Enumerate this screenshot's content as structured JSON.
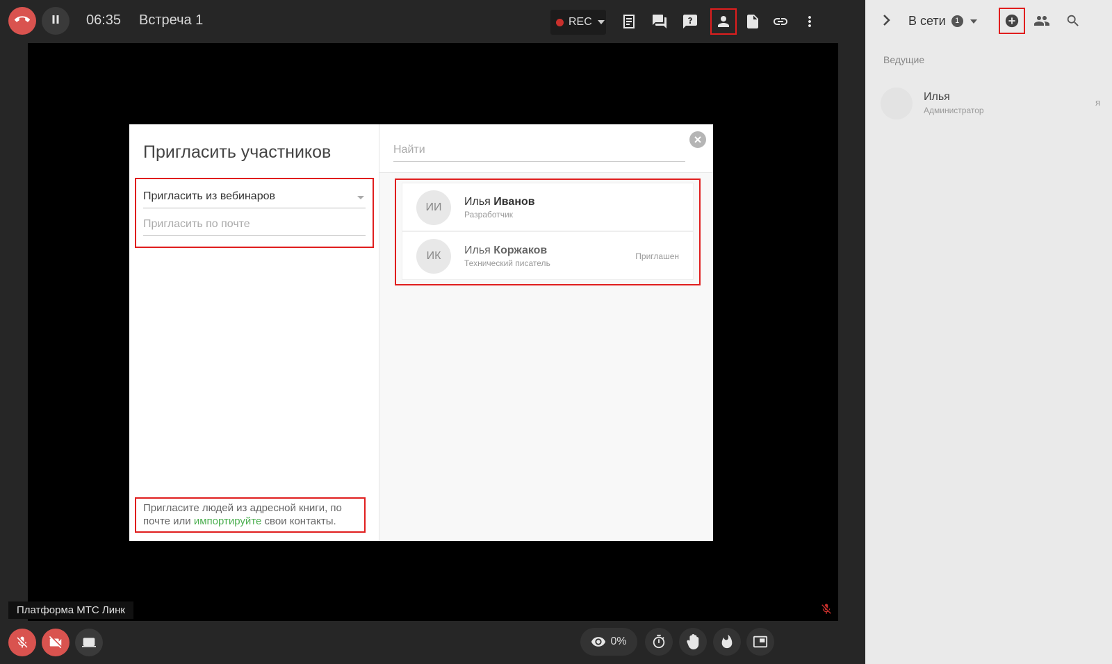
{
  "header": {
    "time": "06:35",
    "title": "Встреча 1",
    "rec_label": "REC"
  },
  "stage": {
    "platform_label": "Платформа МТС Линк",
    "views_percent": "0%"
  },
  "panel": {
    "online_label": "В сети",
    "online_count": "1",
    "section_hosts": "Ведущие",
    "hosts": [
      {
        "name": "Илья",
        "role": "Администратор",
        "me": "я"
      }
    ]
  },
  "modal": {
    "title": "Пригласить участников",
    "invite_from_select": "Пригласить из вебинаров",
    "invite_email_placeholder": "Пригласить по почте",
    "search_placeholder": "Найти",
    "hint_part1": "Пригласите людей из адресной книги, по почте или ",
    "hint_link": "импортируйте",
    "hint_part2": " свои контакты.",
    "contacts": [
      {
        "initials": "ИИ",
        "first": "Илья",
        "last": "Иванов",
        "role": "Разработчик",
        "status": ""
      },
      {
        "initials": "ИК",
        "first": "Илья",
        "last": "Коржаков",
        "role": "Технический писатель",
        "status": "Приглашен"
      }
    ]
  },
  "colors": {
    "accent_red": "#e01e1e",
    "danger_button": "#d9534f",
    "link_green": "#4caf50"
  }
}
